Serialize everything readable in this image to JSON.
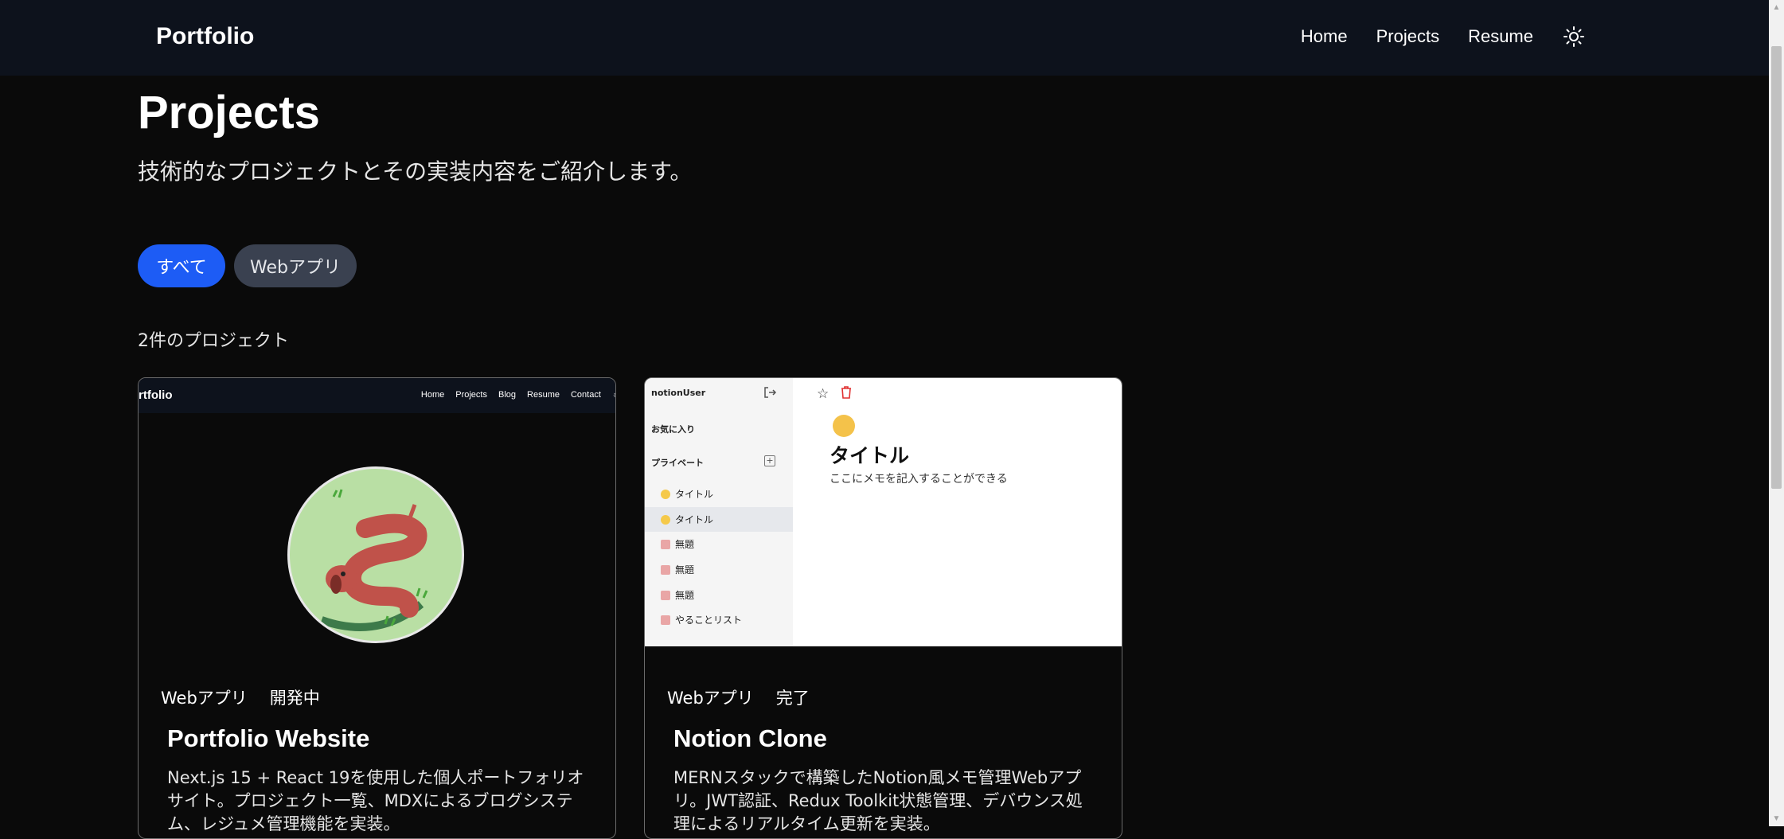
{
  "header": {
    "brand": "Portfolio",
    "nav": [
      "Home",
      "Projects",
      "Resume"
    ],
    "theme_icon": "sun-icon"
  },
  "page": {
    "title": "Projects",
    "subtitle": "技術的なプロジェクトとその実装内容をご紹介します。"
  },
  "filters": {
    "all": "すべて",
    "web": "Webアプリ",
    "active_color": "#1d5cf5"
  },
  "count_text": "2件のプロジェクト",
  "projects": [
    {
      "title": "Portfolio Website",
      "tags": [
        "Webアプリ",
        "開発中"
      ],
      "description": "Next.js 15 + React 19を使用した個人ポートフォリオサイト。プロジェクト一覧、MDXによるブログシステム、レジュメ管理機能を実装。",
      "thumb": {
        "brand": "rtfolio",
        "nav": [
          "Home",
          "Projects",
          "Blog",
          "Resume",
          "Contact"
        ]
      }
    },
    {
      "title": "Notion Clone",
      "tags": [
        "Webアプリ",
        "完了"
      ],
      "description": "MERNスタックで構築したNotion風メモ管理Webアプリ。JWT認証、Redux Toolkit状態管理、デバウンス処理によるリアルタイム更新を実装。",
      "thumb": {
        "user": "notionUser",
        "favorites": "お気に入り",
        "private": "プライベート",
        "items": [
          "タイトル",
          "タイトル",
          "無題",
          "無題",
          "無題",
          "やることリスト"
        ],
        "page_title": "タイトル",
        "memo": "ここにメモを記入することができる"
      }
    }
  ]
}
